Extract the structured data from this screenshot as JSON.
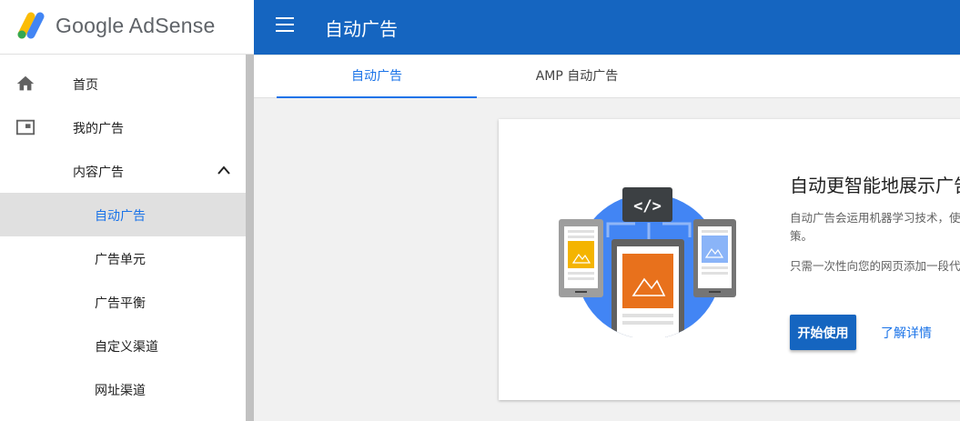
{
  "brand": {
    "name": "Google AdSense"
  },
  "topbar": {
    "title": "自动广告",
    "menu_icon": "menu-icon"
  },
  "sidebar": {
    "items": [
      {
        "label": "首页",
        "icon": "home-icon"
      },
      {
        "label": "我的广告",
        "icon": "ads-icon"
      },
      {
        "label": "内容广告",
        "icon": "chevron-up-icon"
      },
      {
        "label": "自动广告",
        "selected": true
      },
      {
        "label": "广告单元"
      },
      {
        "label": "广告平衡"
      },
      {
        "label": "自定义渠道"
      },
      {
        "label": "网址渠道"
      }
    ]
  },
  "tabs": [
    {
      "label": "自动广告",
      "active": true
    },
    {
      "label": "AMP 自动广告"
    }
  ],
  "card": {
    "heading": "自动更智能地展示广告",
    "desc": "自动广告会运用机器学习技术，使策。",
    "desc2": "只需一次性向您的网页添加一段代",
    "start_button": "开始使用",
    "learn_link": "了解详情",
    "code_badge": "</>"
  },
  "colors": {
    "accent": "#1565c0",
    "link": "#1a73e8",
    "selected_bg": "#e0e0e0",
    "illustration_circle": "#4285f4",
    "orange": "#e8711c",
    "yellow": "#f4b400"
  }
}
